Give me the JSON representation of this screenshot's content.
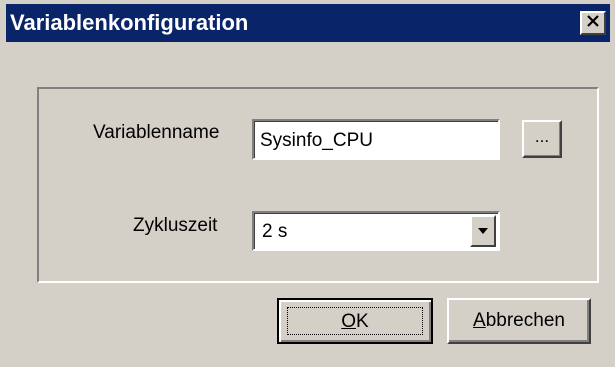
{
  "window": {
    "title": "Variablenkonfiguration",
    "close_glyph": "✕"
  },
  "form": {
    "varname_label": "Variablenname",
    "varname_value": "Sysinfo_CPU",
    "browse_label": "...",
    "cycle_label": "Zykluszeit",
    "cycle_value": "2 s"
  },
  "buttons": {
    "ok_mnemonic": "O",
    "ok_rest": "K",
    "cancel_mnemonic": "A",
    "cancel_rest": "bbrechen"
  },
  "colors": {
    "face": "#d4d0c8",
    "titlebar": "#0a246a",
    "title_text": "#ffffff"
  },
  "icons": {
    "close": "close-icon",
    "dropdown": "chevron-down-icon"
  }
}
